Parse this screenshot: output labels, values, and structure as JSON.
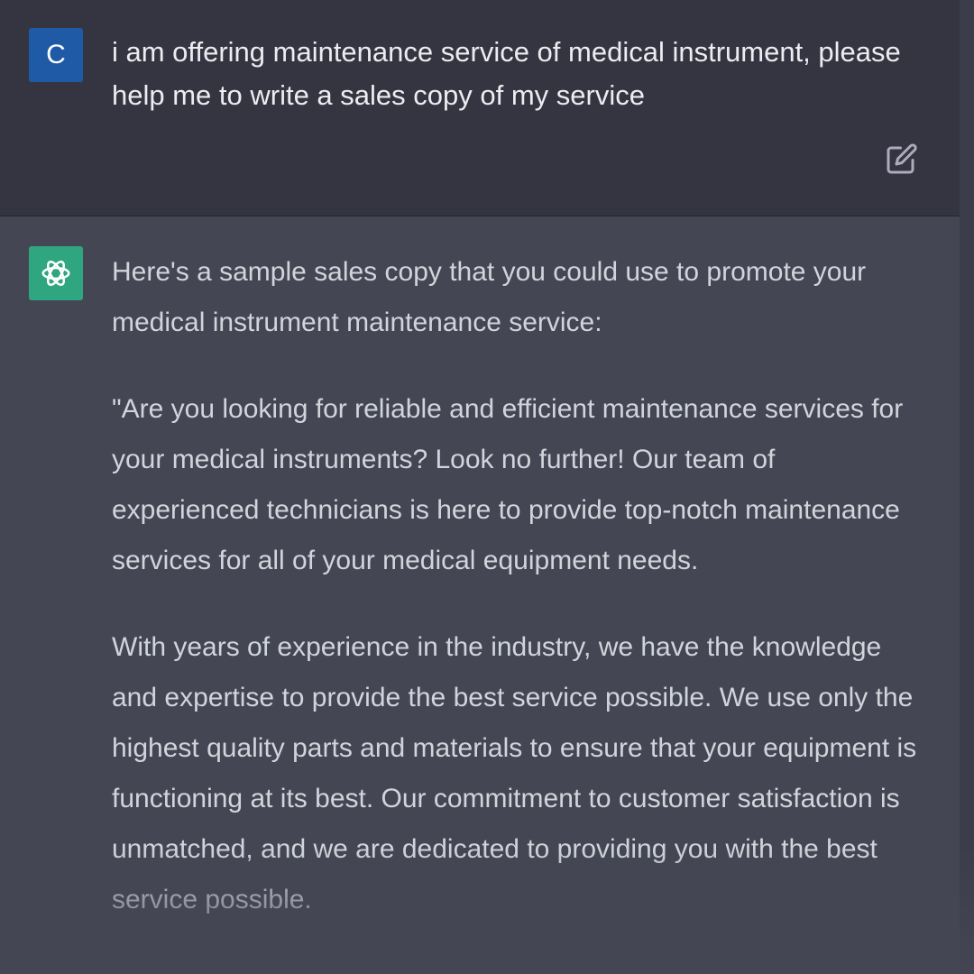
{
  "user_message": {
    "avatar_letter": "C",
    "avatar_color": "#1f5aa6",
    "text": "i am offering maintenance service of medical instrument, please help me to write a sales copy of my service",
    "edit_icon": "edit-icon"
  },
  "assistant_message": {
    "avatar_icon": "openai-logo-icon",
    "avatar_color": "#2fa67f",
    "paragraphs": [
      "Here's a sample sales copy that you could use to promote your medical instrument maintenance service:",
      "\"Are you looking for reliable and efficient maintenance services for your medical instruments? Look no further! Our team of experienced technicians is here to provide top-notch maintenance services for all of your medical equipment needs.",
      "With years of experience in the industry, we have the knowledge and expertise to provide the best service possible. We use only the highest quality parts and materials to ensure that your equipment is functioning at its best. Our commitment to customer satisfaction is unmatched, and we are dedicated to providing you with the best service possible."
    ]
  },
  "colors": {
    "user_bg": "#343541",
    "assistant_bg": "#444654",
    "user_text": "#ececf1",
    "assistant_text": "#d1d5db"
  }
}
